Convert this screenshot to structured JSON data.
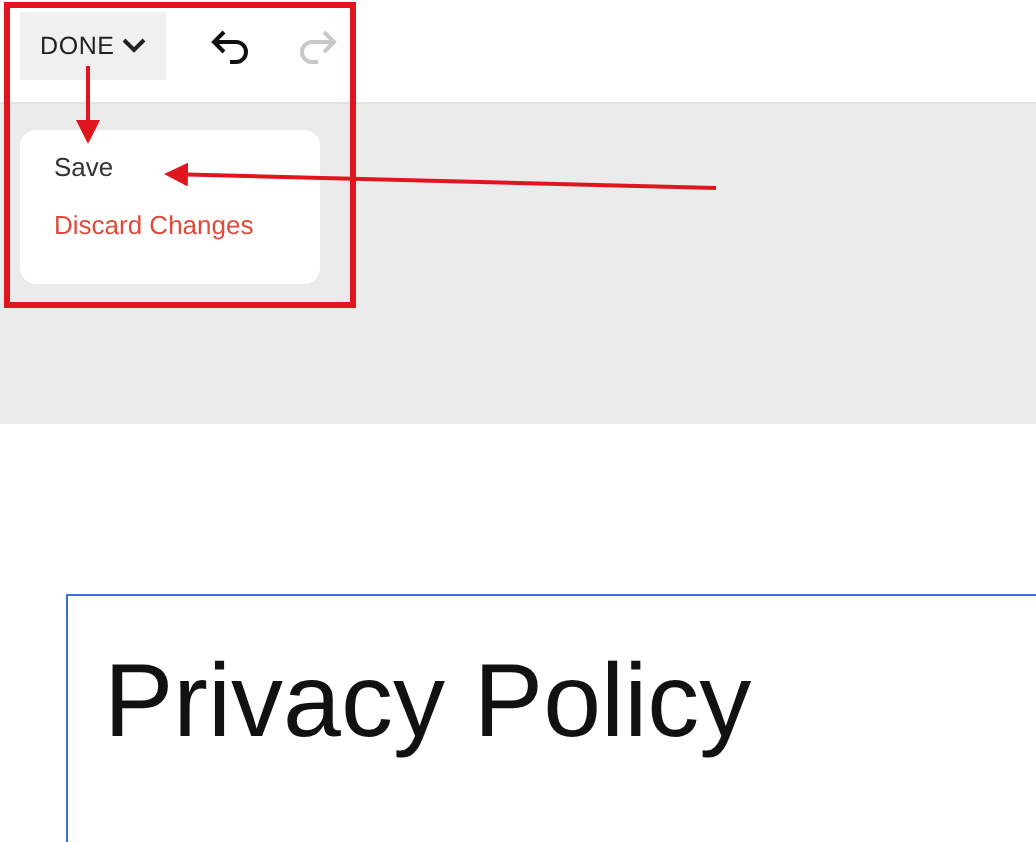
{
  "toolbar": {
    "done_button": {
      "label": "DONE"
    },
    "history": [
      {
        "kind": "undo",
        "disabled": false
      },
      {
        "kind": "redo",
        "disabled": true
      }
    ]
  },
  "done_menu": {
    "items": [
      {
        "label": "Save",
        "kind": "default"
      },
      {
        "label": "Discard Changes",
        "kind": "danger"
      }
    ]
  },
  "page": {
    "title": "Privacy Policy"
  }
}
